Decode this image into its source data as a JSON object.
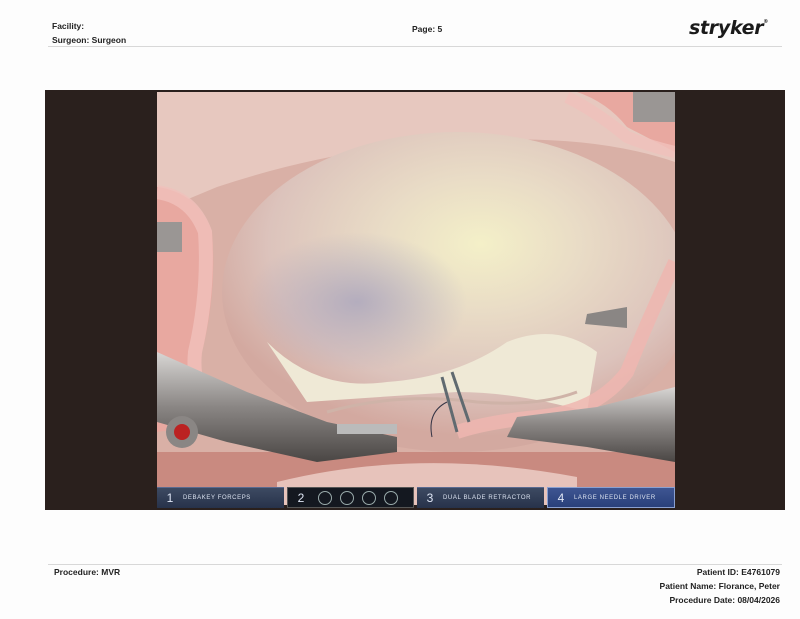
{
  "header": {
    "facility_label": "Facility:",
    "surgeon_label": "Surgeon: Surgeon",
    "page_label": "Page: 5",
    "logo_text": "stryker",
    "logo_mark": "®"
  },
  "video": {
    "tools": [
      {
        "number": "1",
        "label": "DEBAKEY FORCEPS"
      },
      {
        "number": "2",
        "label": ""
      },
      {
        "number": "3",
        "label": "DUAL BLADE RETRACTOR"
      },
      {
        "number": "4",
        "label": "LARGE NEEDLE DRIVER"
      }
    ]
  },
  "footer": {
    "procedure": "Procedure: MVR",
    "patient_id": "Patient ID: E4761079",
    "patient_name": "Patient Name: Florance, Peter",
    "procedure_date": "Procedure Date: 08/04/2026"
  }
}
